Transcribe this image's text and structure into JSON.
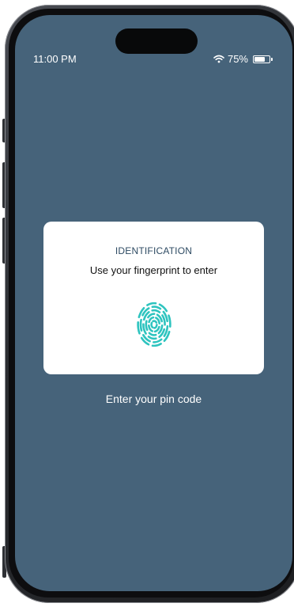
{
  "status_bar": {
    "time": "11:00 PM",
    "battery_percent": "75%",
    "battery_level": 0.75,
    "wifi_icon": "wifi-icon",
    "battery_icon": "battery-icon"
  },
  "card": {
    "title": "IDENTIFICATION",
    "subtitle": "Use your fingerprint to enter",
    "fingerprint_icon": "fingerprint-icon"
  },
  "pin_link": "Enter your pin code",
  "colors": {
    "screen_bg": "#46637a",
    "card_bg": "#ffffff",
    "title": "#2d4a62",
    "fingerprint": "#2ec4bf",
    "text_light": "#ffffff"
  }
}
